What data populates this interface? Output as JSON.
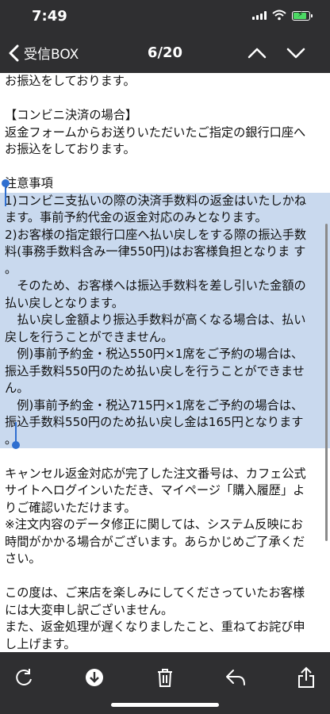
{
  "status_bar": {
    "time": "7:49"
  },
  "nav": {
    "back_label": "受信BOX",
    "counter": "6/20"
  },
  "email": {
    "lines": [
      "お振込をしております。",
      "",
      "【コンビニ決済の場合】",
      "返金フォームからお送りいただいたご指定の銀行口座へ",
      "お振込をしております。",
      "",
      "注意事項",
      "1)コンビニ支払いの際の決済手数料の返金はいたしかね",
      "ます。事前予約代金の返金対応のみとなります。",
      "2)お客様の指定銀行口座へ払い戻しをする際の振込手数",
      "料(事務手数料含み一律550円)はお客様負担となりま す",
      "。",
      "　そのため、お客様へは振込手数料を差し引いた金額の",
      "払い戻しとなります。",
      "　払い戻し金額より振込手数料が高くなる場合は、払い",
      "戻しを行うことができません。",
      "　例)事前予約金・税込550円×1席をご予約の場合は、",
      "振込手数料550円のため払い戻しを行うことができませ",
      "ん。",
      "　例)事前予約金・税込715円×1席をご予約の場合は、",
      "振込手数料550円のため払い戻し金は165円となります",
      "。",
      "",
      "キャンセル返金対応が完了した注文番号は、カフェ公式",
      "サイトへログインいただき、マイページ「購入履歴」よ",
      "りご確認いただけます。",
      "※注文内容のデータ修正に関しては、システム反映にお",
      "時間がかかる場合がございます。あらかじめご了承くだ",
      "さい。",
      "",
      "この度は、ご来店を楽しみにしてくださっていたお客様",
      "には大変申し訳ございません。",
      "また、返金処理が遅くなりましたこと、重ねてお詫び申",
      "し上げます。"
    ]
  },
  "toolbar": {
    "icons": [
      "refresh-icon",
      "download-icon",
      "trash-icon",
      "reply-icon",
      "share-icon"
    ]
  },
  "colors": {
    "bar_bg": "#2f2f31",
    "selection": "#c9d9ee",
    "handle": "#2f6fd0",
    "battery": "#4cd964"
  }
}
